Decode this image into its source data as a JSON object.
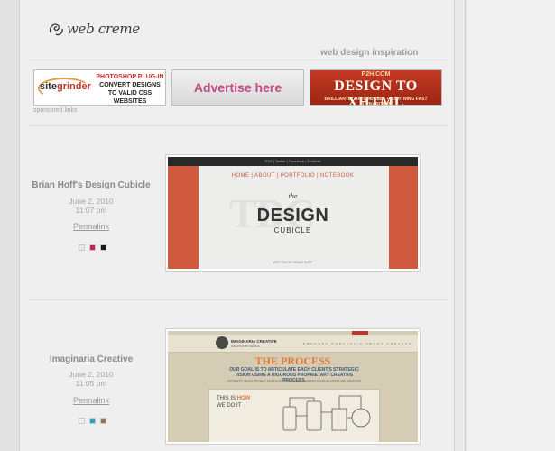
{
  "site": {
    "logo_text": "web creme",
    "tagline": "web design inspiration"
  },
  "ads": {
    "sponsored_label": "sponsored links",
    "sitegrinder": {
      "brand_a": "site",
      "brand_b": "grinder",
      "line1": "PHOTOSHOP PLUG-IN",
      "line2": "CONVERT DESIGNS TO VALID CSS WEBSITES"
    },
    "advertise": {
      "label": "Advertise here"
    },
    "p2h": {
      "line1": "P2H.COM",
      "line2": "DESIGN TO XHTML",
      "line3": "BRILLIANTLY AFFORDABLE • LIGHTNING FAST TURNAROUND"
    }
  },
  "entries": [
    {
      "title": "Brian Hoff's Design Cubicle",
      "date": "June 2, 2010",
      "time": "11:07 pm",
      "permalink_label": "Permalink",
      "swatches": [
        "#e5e5e5",
        "#c0245c",
        "#1a1a1a"
      ],
      "shot": {
        "topbar": "RSS | Twitter | Facebook | Dribbble",
        "nav": "HOME | ABOUT | PORTFOLIO | NOTEBOOK",
        "watermark": "TDC",
        "the": "the",
        "design": "DESIGN",
        "cubicle": "CUBICLE",
        "written": "WRITTEN BY BRIAN HOFF"
      }
    },
    {
      "title": "Imaginaria Creative",
      "date": "June 2, 2010",
      "time": "11:05 pm",
      "permalink_label": "Permalink",
      "swatches": [
        "#f2f0e6",
        "#3a9ac4",
        "#8a7356"
      ],
      "shot": {
        "brand": "IMAGINARIA CREATIVE",
        "brand_sub": "CREATIVE BY DESIGN",
        "nav": "PROCESS  PORTFOLIO  ABOUT  CONTACT",
        "process": "THE PROCESS",
        "goal": "OUR GOAL IS TO ARTICULATE EACH CLIENT'S STRATEGIC VISION USING A RIGOROUS PROPRIETARY CREATIVE PROCESS.",
        "small": "AUTHENTIC • EACH PROJECT MUST ELICIT A REACTION • STIRRING PEOPLE'S MINDS AND EMOTIONS",
        "this_is": "THIS IS",
        "how": "HOW",
        "we_do_it": "WE DO IT"
      }
    }
  ]
}
